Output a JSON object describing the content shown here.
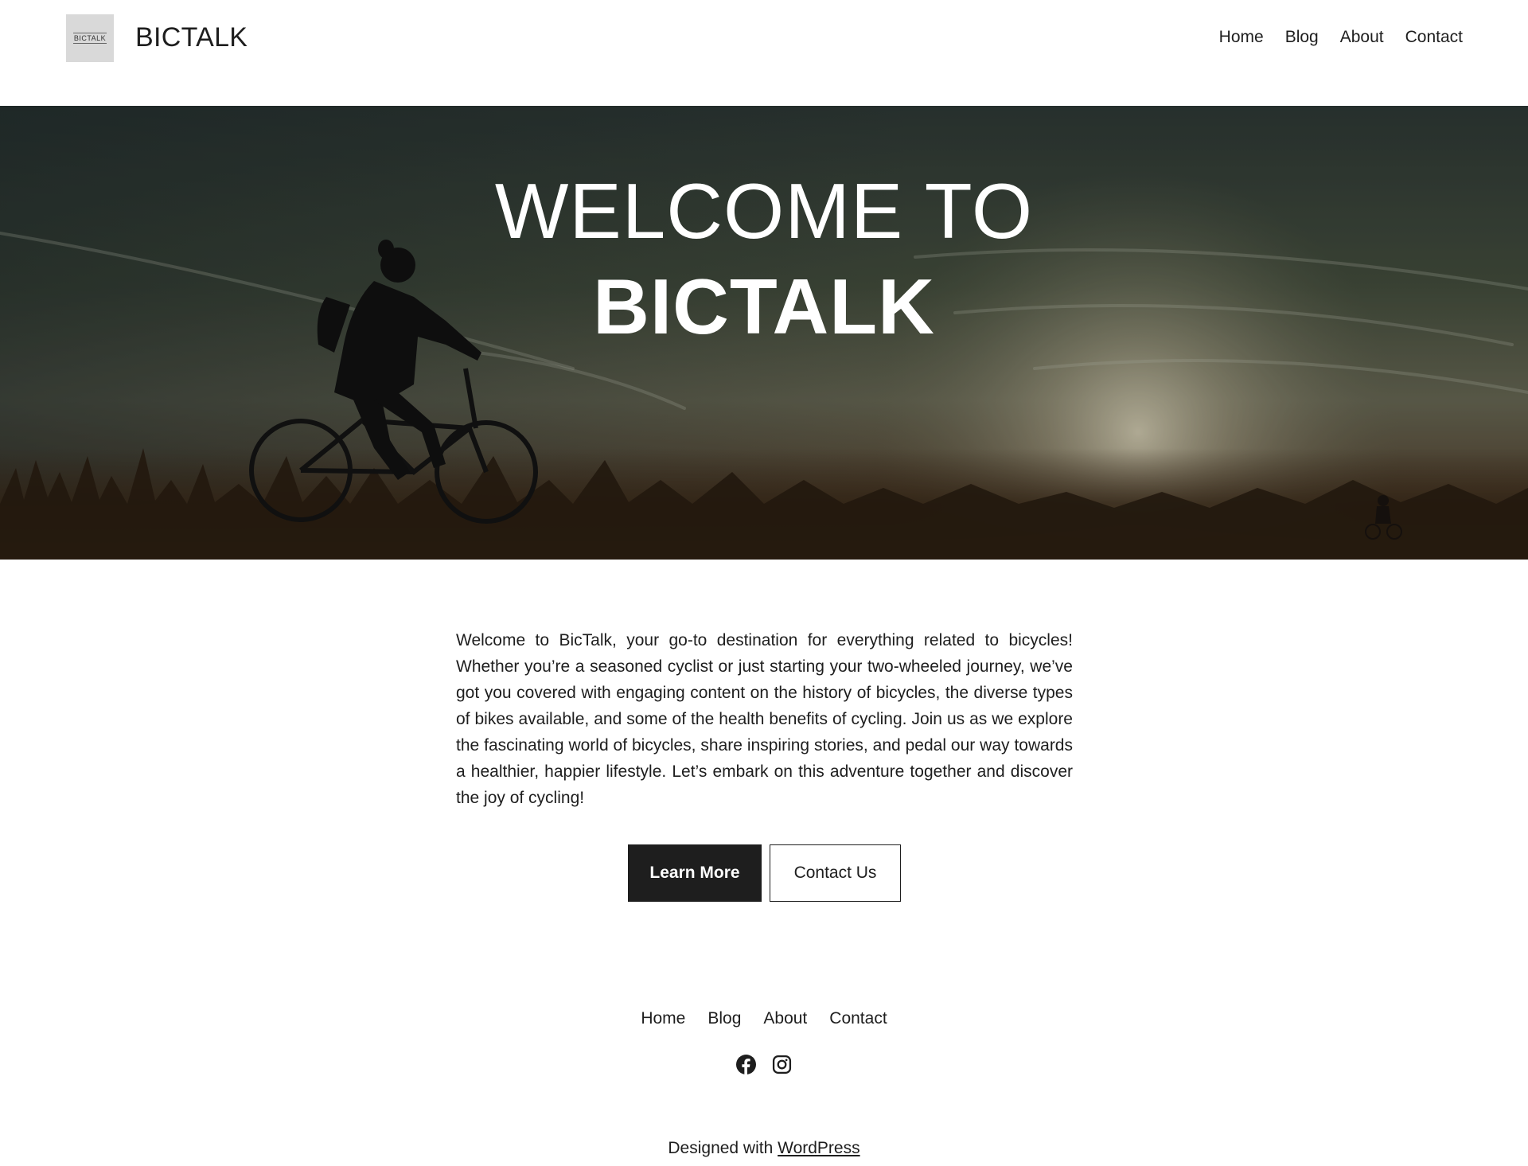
{
  "header": {
    "logo_text": "BICTALK",
    "site_title": "BICTALK",
    "nav": [
      "Home",
      "Blog",
      "About",
      "Contact"
    ]
  },
  "hero": {
    "title_line1": "WELCOME TO",
    "title_line2": "BICTALK"
  },
  "intro": {
    "text": "Welcome to BicTalk, your go-to destination for everything related to bicycles! Whether you’re a seasoned cyclist or just starting your two-wheeled journey, we’ve got you covered with engaging content on the history of bicycles, the diverse types of bikes available, and some of the health benefits of cycling. Join us as we explore the fascinating world of bicycles, share inspiring stories, and pedal our way towards a healthier, happier lifestyle. Let’s embark on this adventure together and discover the joy of cycling!"
  },
  "buttons": {
    "primary": "Learn More",
    "secondary": "Contact Us"
  },
  "footer": {
    "nav": [
      "Home",
      "Blog",
      "About",
      "Contact"
    ],
    "social_icons": [
      "facebook-icon",
      "instagram-icon"
    ],
    "credit_prefix": "Designed with ",
    "credit_link": "WordPress"
  },
  "colors": {
    "text": "#1e1e1e",
    "button_dark": "#1e1e1e",
    "background": "#ffffff",
    "logo_bg": "#d9d9d9"
  }
}
